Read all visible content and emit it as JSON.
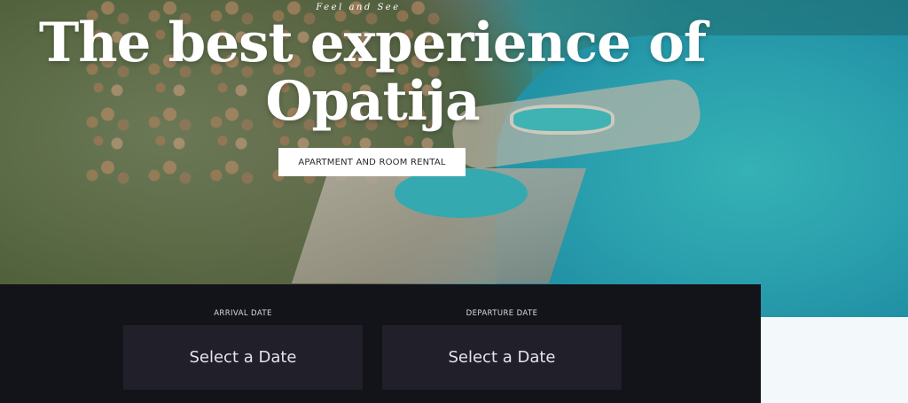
{
  "hero": {
    "tagline": "Feel and See",
    "headline_line1": "The best experience of",
    "headline_line2": "Opatija",
    "cta_label": "APARTMENT AND ROOM RENTAL"
  },
  "booking": {
    "arrival": {
      "label": "ARRIVAL DATE",
      "value": "Select a Date"
    },
    "departure": {
      "label": "DEPARTURE DATE",
      "value": "Select a Date"
    }
  },
  "colors": {
    "panel_bg": "#131419",
    "date_box_bg": "#201f2a",
    "cta_bg": "#ffffff",
    "page_bg": "#f3f9fb"
  }
}
